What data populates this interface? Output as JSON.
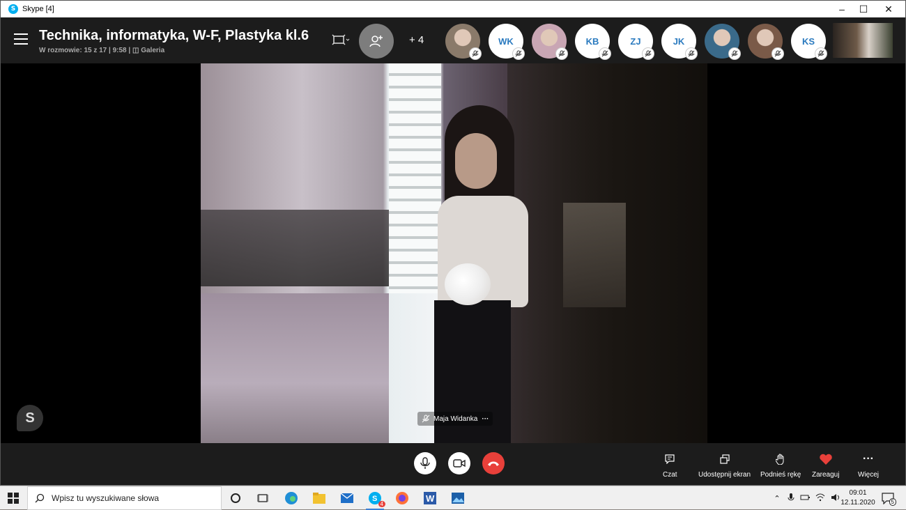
{
  "window": {
    "title": "Skype [4]",
    "app_icon_letter": "S"
  },
  "call": {
    "title": "Technika, informatyka, W-F, Plastyka kl.6",
    "subtitle": "W rozmowie: 15 z 17  | 9:58 |",
    "view_mode": "Galeria",
    "extra_participants": "+ 4"
  },
  "participants": [
    {
      "initials": "",
      "photo": true
    },
    {
      "initials": "WK",
      "photo": false
    },
    {
      "initials": "",
      "photo": true
    },
    {
      "initials": "KB",
      "photo": false
    },
    {
      "initials": "ZJ",
      "photo": false
    },
    {
      "initials": "JK",
      "photo": false
    },
    {
      "initials": "",
      "photo": true
    },
    {
      "initials": "",
      "photo": true
    },
    {
      "initials": "KS",
      "photo": false
    }
  ],
  "video": {
    "speaker_name": "Maja Widanka",
    "more": "···"
  },
  "watermark": "S",
  "toolbar": {
    "chat": "Czat",
    "share_screen": "Udostępnij ekran",
    "raise_hand": "Podnieś rękę",
    "react": "Zareaguj",
    "more": "Więcej"
  },
  "taskbar": {
    "search_placeholder": "Wpisz tu wyszukiwane słowa",
    "skype_badge": "4",
    "time": "09:01",
    "date": "12.11.2020",
    "notification_count": "5"
  },
  "colors": {
    "end_call": "#e8403a",
    "heart": "#e8403a",
    "avatar_text": "#2a7abf",
    "header_bg": "#1c1c1c"
  }
}
